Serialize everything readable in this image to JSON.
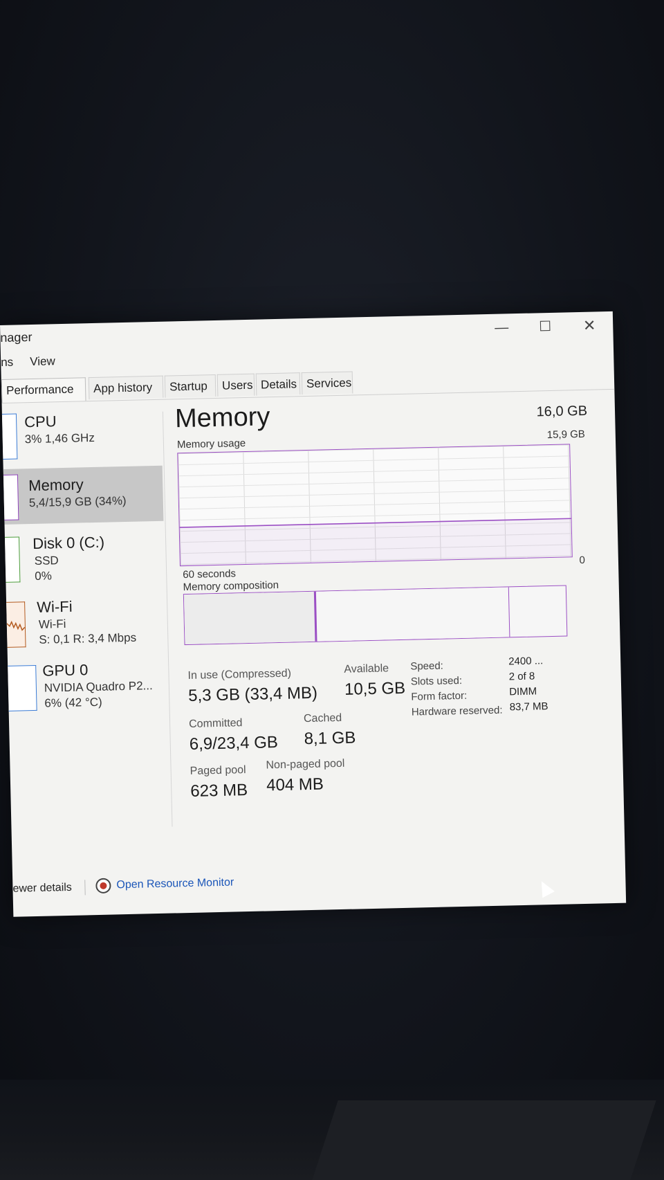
{
  "window": {
    "title": "nager",
    "controls": {
      "minimize": "—",
      "maximize": "☐",
      "close": "✕"
    }
  },
  "menu": {
    "items": [
      "ns",
      "View"
    ]
  },
  "tabs": [
    "Performance",
    "App history",
    "Startup",
    "Users",
    "Details",
    "Services"
  ],
  "sidebar": {
    "cpu": {
      "name": "CPU",
      "sub": "3% 1,46 GHz"
    },
    "memory": {
      "name": "Memory",
      "sub": "5,4/15,9 GB (34%)"
    },
    "disk": {
      "name": "Disk 0 (C:)",
      "sub1": "SSD",
      "sub2": "0%"
    },
    "wifi": {
      "name": "Wi-Fi",
      "sub1": "Wi-Fi",
      "sub2": "S: 0,1 R: 3,4 Mbps"
    },
    "gpu": {
      "name": "GPU 0",
      "sub1": "NVIDIA Quadro P2...",
      "sub2": "6% (42 °C)"
    }
  },
  "main": {
    "title": "Memory",
    "total": "16,0 GB",
    "usage_label": "Memory usage",
    "usage_max": "15,9 GB",
    "time_label": "60 seconds",
    "zero_label": "0",
    "composition_label": "Memory composition",
    "usage_fraction": 0.34,
    "stats": {
      "in_use_label": "In use (Compressed)",
      "in_use_value": "5,3 GB (33,4 MB)",
      "available_label": "Available",
      "available_value": "10,5 GB",
      "committed_label": "Committed",
      "committed_value": "6,9/23,4 GB",
      "cached_label": "Cached",
      "cached_value": "8,1 GB",
      "paged_label": "Paged pool",
      "paged_value": "623 MB",
      "nonpaged_label": "Non-paged pool",
      "nonpaged_value": "404 MB"
    },
    "details": {
      "speed_label": "Speed:",
      "speed_value": "2400 ...",
      "slots_label": "Slots used:",
      "slots_value": "2 of 8",
      "form_label": "Form factor:",
      "form_value": "DIMM",
      "hw_label": "Hardware reserved:",
      "hw_value": "83,7 MB"
    }
  },
  "footer": {
    "fewer_details": "ewer details",
    "resource_monitor": "Open Resource Monitor"
  },
  "colors": {
    "memory_accent": "#9b4fc4",
    "link": "#1a55b8"
  }
}
